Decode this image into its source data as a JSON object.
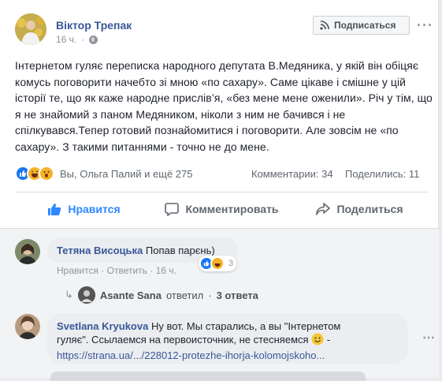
{
  "post": {
    "author": "Віктор Трепак",
    "time": "16 ч.",
    "subscribe_label": "Подписаться",
    "more_label": "···",
    "text": "Інтернетом гуляє переписка народного депутата В.Медяника, у якій він обіцяє комусь поговорити начебто зі мною «по сахару». Саме цікаве і смішне у цій історії те, що як каже народне прислів’я, «без мене мене оженили». Річ у тім, що я не знайомий з паном Медяником, ніколи з ним не бачився і не спілкувався.Тепер готовий познайомитися і поговорити. Але зовсім не «по сахару». З такими питаннями - точно не до мене."
  },
  "reactions": {
    "names": "Вы, Ольга Палий и ещё 275",
    "comments": "Комментарии: 34",
    "shares": "Поделились: 11"
  },
  "actions": {
    "like": "Нравится",
    "comment": "Комментировать",
    "share": "Поделиться"
  },
  "comments": [
    {
      "name": "Тетяна Висоцька",
      "text": "Попав парєнь)",
      "like": "Нравится",
      "reply": "Ответить",
      "time": "16 ч.",
      "react_count": "3",
      "replies": {
        "name": "Asante Sana",
        "verb": "ответил",
        "count": "3 ответа"
      }
    },
    {
      "name": "Svetlana Kryukova",
      "text1": "Ну вот. Мы старались, а вы \"Інтернетом",
      "text2": "гуляє\". Ссылаемся на первоисточник, не стесняемся",
      "text2_tail": " -",
      "link": "https://strana.ua/.../228012-protezhe-ihorja-kolomojskoho..."
    }
  ],
  "colors": {
    "link": "#385898",
    "like_active": "#2d88ff",
    "muted": "#90949c"
  }
}
